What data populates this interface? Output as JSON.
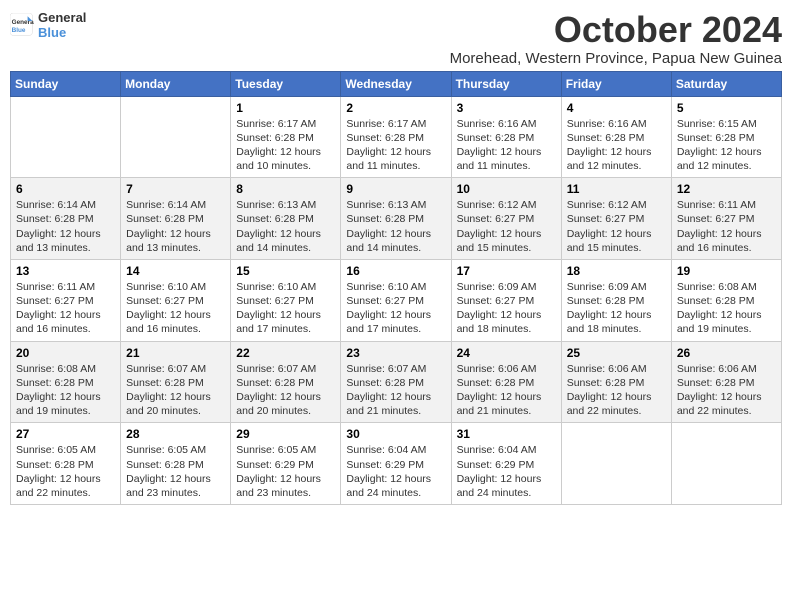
{
  "logo": {
    "line1": "General",
    "line2": "Blue"
  },
  "title": "October 2024",
  "location": "Morehead, Western Province, Papua New Guinea",
  "days_header": [
    "Sunday",
    "Monday",
    "Tuesday",
    "Wednesday",
    "Thursday",
    "Friday",
    "Saturday"
  ],
  "weeks": [
    [
      {
        "day": "",
        "info": ""
      },
      {
        "day": "",
        "info": ""
      },
      {
        "day": "1",
        "info": "Sunrise: 6:17 AM\nSunset: 6:28 PM\nDaylight: 12 hours and 10 minutes."
      },
      {
        "day": "2",
        "info": "Sunrise: 6:17 AM\nSunset: 6:28 PM\nDaylight: 12 hours and 11 minutes."
      },
      {
        "day": "3",
        "info": "Sunrise: 6:16 AM\nSunset: 6:28 PM\nDaylight: 12 hours and 11 minutes."
      },
      {
        "day": "4",
        "info": "Sunrise: 6:16 AM\nSunset: 6:28 PM\nDaylight: 12 hours and 12 minutes."
      },
      {
        "day": "5",
        "info": "Sunrise: 6:15 AM\nSunset: 6:28 PM\nDaylight: 12 hours and 12 minutes."
      }
    ],
    [
      {
        "day": "6",
        "info": "Sunrise: 6:14 AM\nSunset: 6:28 PM\nDaylight: 12 hours and 13 minutes."
      },
      {
        "day": "7",
        "info": "Sunrise: 6:14 AM\nSunset: 6:28 PM\nDaylight: 12 hours and 13 minutes."
      },
      {
        "day": "8",
        "info": "Sunrise: 6:13 AM\nSunset: 6:28 PM\nDaylight: 12 hours and 14 minutes."
      },
      {
        "day": "9",
        "info": "Sunrise: 6:13 AM\nSunset: 6:28 PM\nDaylight: 12 hours and 14 minutes."
      },
      {
        "day": "10",
        "info": "Sunrise: 6:12 AM\nSunset: 6:27 PM\nDaylight: 12 hours and 15 minutes."
      },
      {
        "day": "11",
        "info": "Sunrise: 6:12 AM\nSunset: 6:27 PM\nDaylight: 12 hours and 15 minutes."
      },
      {
        "day": "12",
        "info": "Sunrise: 6:11 AM\nSunset: 6:27 PM\nDaylight: 12 hours and 16 minutes."
      }
    ],
    [
      {
        "day": "13",
        "info": "Sunrise: 6:11 AM\nSunset: 6:27 PM\nDaylight: 12 hours and 16 minutes."
      },
      {
        "day": "14",
        "info": "Sunrise: 6:10 AM\nSunset: 6:27 PM\nDaylight: 12 hours and 16 minutes."
      },
      {
        "day": "15",
        "info": "Sunrise: 6:10 AM\nSunset: 6:27 PM\nDaylight: 12 hours and 17 minutes."
      },
      {
        "day": "16",
        "info": "Sunrise: 6:10 AM\nSunset: 6:27 PM\nDaylight: 12 hours and 17 minutes."
      },
      {
        "day": "17",
        "info": "Sunrise: 6:09 AM\nSunset: 6:27 PM\nDaylight: 12 hours and 18 minutes."
      },
      {
        "day": "18",
        "info": "Sunrise: 6:09 AM\nSunset: 6:28 PM\nDaylight: 12 hours and 18 minutes."
      },
      {
        "day": "19",
        "info": "Sunrise: 6:08 AM\nSunset: 6:28 PM\nDaylight: 12 hours and 19 minutes."
      }
    ],
    [
      {
        "day": "20",
        "info": "Sunrise: 6:08 AM\nSunset: 6:28 PM\nDaylight: 12 hours and 19 minutes."
      },
      {
        "day": "21",
        "info": "Sunrise: 6:07 AM\nSunset: 6:28 PM\nDaylight: 12 hours and 20 minutes."
      },
      {
        "day": "22",
        "info": "Sunrise: 6:07 AM\nSunset: 6:28 PM\nDaylight: 12 hours and 20 minutes."
      },
      {
        "day": "23",
        "info": "Sunrise: 6:07 AM\nSunset: 6:28 PM\nDaylight: 12 hours and 21 minutes."
      },
      {
        "day": "24",
        "info": "Sunrise: 6:06 AM\nSunset: 6:28 PM\nDaylight: 12 hours and 21 minutes."
      },
      {
        "day": "25",
        "info": "Sunrise: 6:06 AM\nSunset: 6:28 PM\nDaylight: 12 hours and 22 minutes."
      },
      {
        "day": "26",
        "info": "Sunrise: 6:06 AM\nSunset: 6:28 PM\nDaylight: 12 hours and 22 minutes."
      }
    ],
    [
      {
        "day": "27",
        "info": "Sunrise: 6:05 AM\nSunset: 6:28 PM\nDaylight: 12 hours and 22 minutes."
      },
      {
        "day": "28",
        "info": "Sunrise: 6:05 AM\nSunset: 6:28 PM\nDaylight: 12 hours and 23 minutes."
      },
      {
        "day": "29",
        "info": "Sunrise: 6:05 AM\nSunset: 6:29 PM\nDaylight: 12 hours and 23 minutes."
      },
      {
        "day": "30",
        "info": "Sunrise: 6:04 AM\nSunset: 6:29 PM\nDaylight: 12 hours and 24 minutes."
      },
      {
        "day": "31",
        "info": "Sunrise: 6:04 AM\nSunset: 6:29 PM\nDaylight: 12 hours and 24 minutes."
      },
      {
        "day": "",
        "info": ""
      },
      {
        "day": "",
        "info": ""
      }
    ]
  ]
}
